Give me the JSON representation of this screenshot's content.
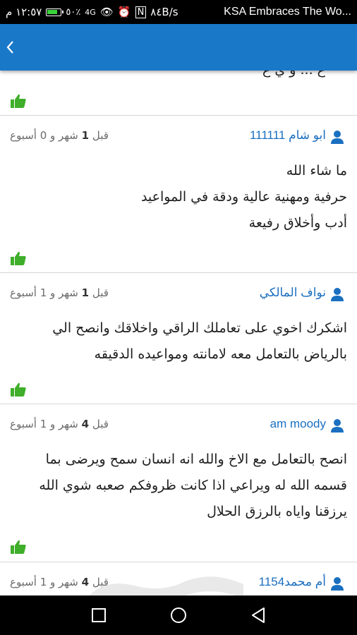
{
  "status_bar": {
    "time": "١٢:٥٧ م",
    "battery": "٥٠٪",
    "speed": "٨٤B/s",
    "signal": "4G",
    "notification_text": "KSA Embraces The Wo..."
  },
  "app_bar": {
    "back_icon": "chevron-left-icon",
    "color": "#1a78c9"
  },
  "cut_off_text": "ع ... و ي ع",
  "reviews": [
    {
      "user": "ابو شام 111111",
      "time_prefix": "قبل",
      "time_num": "1",
      "time_suffix": "شهر و 0 أسبوع",
      "lines": [
        "ما شاء الله",
        "حرفية ومهنية عالية ودقة في المواعيد",
        "أدب وأخلاق رفيعة"
      ]
    },
    {
      "user": "نواف المالكي",
      "time_prefix": "قبل",
      "time_num": "1",
      "time_suffix": "شهر و 1 أسبوع",
      "lines": [
        "اشكرك اخوي على تعاملك الراقي واخلاقك وانصح الي",
        "بالرياض  بالتعامل معه لامانته ومواعيده الدقيقه"
      ]
    },
    {
      "user": "am moody",
      "time_prefix": "قبل",
      "time_num": "4",
      "time_suffix": "شهر و 1 أسبوع",
      "lines": [
        "انصح بالتعامل مع الاخ والله انه انسان سمح ويرضى بما",
        "قسمه الله له ويراعي اذا كانت ظروفكم صعبه شوي الله",
        "يرزقنا واياه بالرزق الحلال"
      ]
    },
    {
      "user": "أم محمد1154",
      "time_prefix": "قبل",
      "time_num": "4",
      "time_suffix": "شهر و 1 أسبوع",
      "lines": []
    }
  ],
  "like_icon": "thumbs-up-icon",
  "like_color": "#3fae2a",
  "user_icon": "user-icon",
  "user_color": "#1a6fc0",
  "nav": {
    "square": "recents-icon",
    "circle": "home-icon",
    "triangle": "back-icon"
  }
}
